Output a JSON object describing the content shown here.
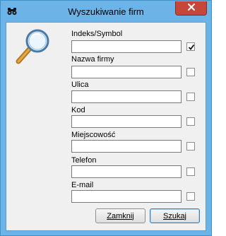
{
  "window": {
    "title": "Wyszukiwanie firm",
    "icon": "binoculars-icon",
    "close_icon": "close-icon"
  },
  "search_icon": "magnifier-icon",
  "fields": [
    {
      "label": "Indeks/Symbol",
      "value": "",
      "checked": true
    },
    {
      "label": "Nazwa firmy",
      "value": "",
      "checked": false
    },
    {
      "label": "Ulica",
      "value": "",
      "checked": false
    },
    {
      "label": "Kod",
      "value": "",
      "checked": false
    },
    {
      "label": "Miejscowość",
      "value": "",
      "checked": false
    },
    {
      "label": "Telefon",
      "value": "",
      "checked": false
    },
    {
      "label": "E-mail",
      "value": "",
      "checked": false
    }
  ],
  "buttons": {
    "close_label": "Zamknij",
    "search_label": "Szukaj"
  },
  "colors": {
    "title_bar": "#6cb4e8",
    "close_button": "#c7463c",
    "client_bg": "#f0f0f0"
  }
}
